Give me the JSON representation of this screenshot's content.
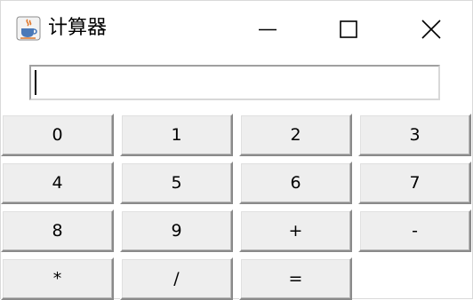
{
  "window": {
    "title": "计算器",
    "icon": "java-coffee-cup-icon",
    "controls": [
      "minimize-icon",
      "maximize-icon",
      "close-icon"
    ]
  },
  "display": {
    "value": "",
    "placeholder": ""
  },
  "keypad": {
    "keys": [
      "0",
      "1",
      "2",
      "3",
      "4",
      "5",
      "6",
      "7",
      "8",
      "9",
      "+",
      "-",
      "*",
      "/",
      "="
    ]
  },
  "colors": {
    "button_face": "#eeeeee",
    "window_bg": "#ffffff",
    "icon_accent": "#e0772a"
  }
}
